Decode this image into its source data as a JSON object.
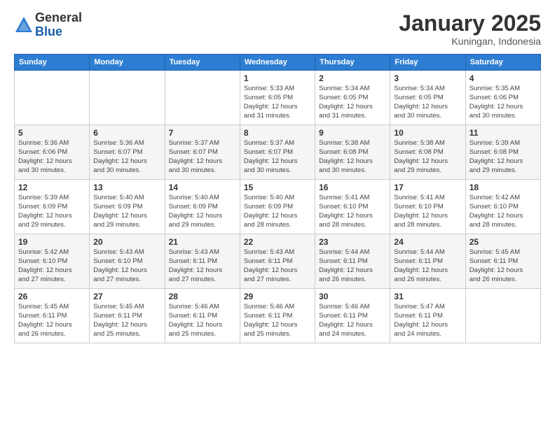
{
  "header": {
    "logo_general": "General",
    "logo_blue": "Blue",
    "month_title": "January 2025",
    "location": "Kuningan, Indonesia"
  },
  "days_of_week": [
    "Sunday",
    "Monday",
    "Tuesday",
    "Wednesday",
    "Thursday",
    "Friday",
    "Saturday"
  ],
  "weeks": [
    [
      {
        "day": "",
        "info": ""
      },
      {
        "day": "",
        "info": ""
      },
      {
        "day": "",
        "info": ""
      },
      {
        "day": "1",
        "info": "Sunrise: 5:33 AM\nSunset: 6:05 PM\nDaylight: 12 hours\nand 31 minutes."
      },
      {
        "day": "2",
        "info": "Sunrise: 5:34 AM\nSunset: 6:05 PM\nDaylight: 12 hours\nand 31 minutes."
      },
      {
        "day": "3",
        "info": "Sunrise: 5:34 AM\nSunset: 6:05 PM\nDaylight: 12 hours\nand 30 minutes."
      },
      {
        "day": "4",
        "info": "Sunrise: 5:35 AM\nSunset: 6:06 PM\nDaylight: 12 hours\nand 30 minutes."
      }
    ],
    [
      {
        "day": "5",
        "info": "Sunrise: 5:36 AM\nSunset: 6:06 PM\nDaylight: 12 hours\nand 30 minutes."
      },
      {
        "day": "6",
        "info": "Sunrise: 5:36 AM\nSunset: 6:07 PM\nDaylight: 12 hours\nand 30 minutes."
      },
      {
        "day": "7",
        "info": "Sunrise: 5:37 AM\nSunset: 6:07 PM\nDaylight: 12 hours\nand 30 minutes."
      },
      {
        "day": "8",
        "info": "Sunrise: 5:37 AM\nSunset: 6:07 PM\nDaylight: 12 hours\nand 30 minutes."
      },
      {
        "day": "9",
        "info": "Sunrise: 5:38 AM\nSunset: 6:08 PM\nDaylight: 12 hours\nand 30 minutes."
      },
      {
        "day": "10",
        "info": "Sunrise: 5:38 AM\nSunset: 6:08 PM\nDaylight: 12 hours\nand 29 minutes."
      },
      {
        "day": "11",
        "info": "Sunrise: 5:39 AM\nSunset: 6:08 PM\nDaylight: 12 hours\nand 29 minutes."
      }
    ],
    [
      {
        "day": "12",
        "info": "Sunrise: 5:39 AM\nSunset: 6:09 PM\nDaylight: 12 hours\nand 29 minutes."
      },
      {
        "day": "13",
        "info": "Sunrise: 5:40 AM\nSunset: 6:09 PM\nDaylight: 12 hours\nand 29 minutes."
      },
      {
        "day": "14",
        "info": "Sunrise: 5:40 AM\nSunset: 6:09 PM\nDaylight: 12 hours\nand 29 minutes."
      },
      {
        "day": "15",
        "info": "Sunrise: 5:40 AM\nSunset: 6:09 PM\nDaylight: 12 hours\nand 28 minutes."
      },
      {
        "day": "16",
        "info": "Sunrise: 5:41 AM\nSunset: 6:10 PM\nDaylight: 12 hours\nand 28 minutes."
      },
      {
        "day": "17",
        "info": "Sunrise: 5:41 AM\nSunset: 6:10 PM\nDaylight: 12 hours\nand 28 minutes."
      },
      {
        "day": "18",
        "info": "Sunrise: 5:42 AM\nSunset: 6:10 PM\nDaylight: 12 hours\nand 28 minutes."
      }
    ],
    [
      {
        "day": "19",
        "info": "Sunrise: 5:42 AM\nSunset: 6:10 PM\nDaylight: 12 hours\nand 27 minutes."
      },
      {
        "day": "20",
        "info": "Sunrise: 5:43 AM\nSunset: 6:10 PM\nDaylight: 12 hours\nand 27 minutes."
      },
      {
        "day": "21",
        "info": "Sunrise: 5:43 AM\nSunset: 6:11 PM\nDaylight: 12 hours\nand 27 minutes."
      },
      {
        "day": "22",
        "info": "Sunrise: 5:43 AM\nSunset: 6:11 PM\nDaylight: 12 hours\nand 27 minutes."
      },
      {
        "day": "23",
        "info": "Sunrise: 5:44 AM\nSunset: 6:11 PM\nDaylight: 12 hours\nand 26 minutes."
      },
      {
        "day": "24",
        "info": "Sunrise: 5:44 AM\nSunset: 6:11 PM\nDaylight: 12 hours\nand 26 minutes."
      },
      {
        "day": "25",
        "info": "Sunrise: 5:45 AM\nSunset: 6:11 PM\nDaylight: 12 hours\nand 26 minutes."
      }
    ],
    [
      {
        "day": "26",
        "info": "Sunrise: 5:45 AM\nSunset: 6:11 PM\nDaylight: 12 hours\nand 26 minutes."
      },
      {
        "day": "27",
        "info": "Sunrise: 5:45 AM\nSunset: 6:11 PM\nDaylight: 12 hours\nand 25 minutes."
      },
      {
        "day": "28",
        "info": "Sunrise: 5:46 AM\nSunset: 6:11 PM\nDaylight: 12 hours\nand 25 minutes."
      },
      {
        "day": "29",
        "info": "Sunrise: 5:46 AM\nSunset: 6:11 PM\nDaylight: 12 hours\nand 25 minutes."
      },
      {
        "day": "30",
        "info": "Sunrise: 5:46 AM\nSunset: 6:11 PM\nDaylight: 12 hours\nand 24 minutes."
      },
      {
        "day": "31",
        "info": "Sunrise: 5:47 AM\nSunset: 6:11 PM\nDaylight: 12 hours\nand 24 minutes."
      },
      {
        "day": "",
        "info": ""
      }
    ]
  ]
}
